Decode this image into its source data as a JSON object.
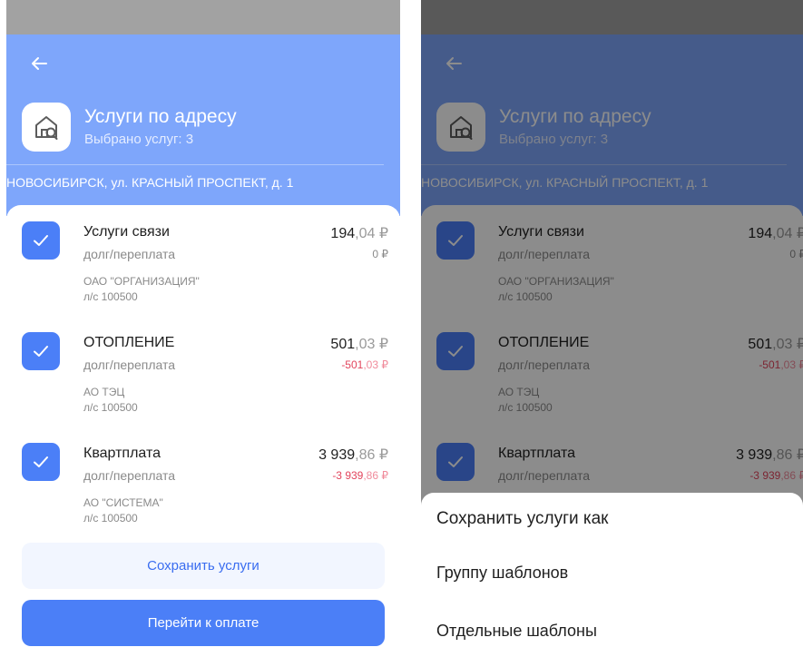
{
  "header": {
    "title": "Услуги по адресу",
    "subtitle": "Выбрано услуг: 3",
    "address": "НОВОСИБИРСК, ул. КРАСНЫЙ ПРОСПЕКТ, д. 1"
  },
  "services": [
    {
      "name": "Услуги связи",
      "debt_label": "долг/переплата",
      "amount_int": "194",
      "amount_frac": ",04 ₽",
      "debt": "0 ₽",
      "org": "ОАО \"ОРГАНИЗАЦИЯ\"",
      "account": "л/с 100500",
      "checked": true
    },
    {
      "name": "ОТОПЛЕНИЕ",
      "debt_label": "долг/переплата",
      "amount_int": "501",
      "amount_frac": ",03 ₽",
      "debt_int": "-501",
      "debt_frac": ",03 ₽",
      "org": "АО ТЭЦ",
      "account": "л/с 100500",
      "checked": true
    },
    {
      "name": "Квартплата",
      "debt_label": "долг/переплата",
      "amount_int": "3 939",
      "amount_frac": ",86 ₽",
      "debt_int": "-3 939",
      "debt_frac": ",86 ₽",
      "org": "АО \"СИСТЕМА\"",
      "account": "л/с 100500",
      "checked": true
    }
  ],
  "buttons": {
    "save": "Сохранить услуги",
    "pay": "Перейти к оплате"
  },
  "action_sheet": {
    "title": "Сохранить услуги как",
    "options": [
      "Группу шаблонов",
      "Отдельные шаблоны"
    ]
  },
  "colors": {
    "header_bg": "#7ea6fb",
    "accent": "#4b7ff7",
    "negative": "#e2445c"
  },
  "icons": {
    "back": "arrow-left-icon",
    "app": "house-search-icon",
    "check": "checkmark-icon"
  }
}
